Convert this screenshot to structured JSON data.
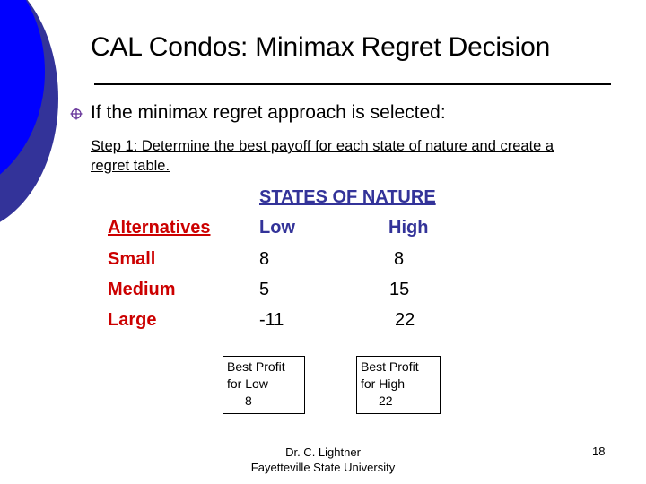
{
  "slide": {
    "title": "CAL Condos: Minimax Regret Decision",
    "bullet": "If the minimax regret approach is selected:",
    "step": "Step 1: Determine the best payoff for each state of nature and create a regret table.",
    "colors": {
      "alternatives": "#cc0000",
      "states": "#333399",
      "circle_front": "#0000ff",
      "circle_back": "#333399"
    }
  },
  "table": {
    "states_header": "STATES OF NATURE",
    "alternatives_header": "Alternatives",
    "columns": [
      "Low",
      "High"
    ],
    "rows": [
      {
        "label": "Small",
        "low": "8",
        "high": "8"
      },
      {
        "label": "Medium",
        "low": "5",
        "high": "15"
      },
      {
        "label": "Large",
        "low": "-11",
        "high": "22"
      }
    ]
  },
  "callouts": [
    {
      "line1": "Best Profit",
      "line2": "for Low",
      "value": "8"
    },
    {
      "line1": "Best Profit",
      "line2": "for High",
      "value": "22"
    }
  ],
  "footer": {
    "author": "Dr. C. Lightner",
    "institution": "Fayetteville State University",
    "page_number": "18"
  }
}
